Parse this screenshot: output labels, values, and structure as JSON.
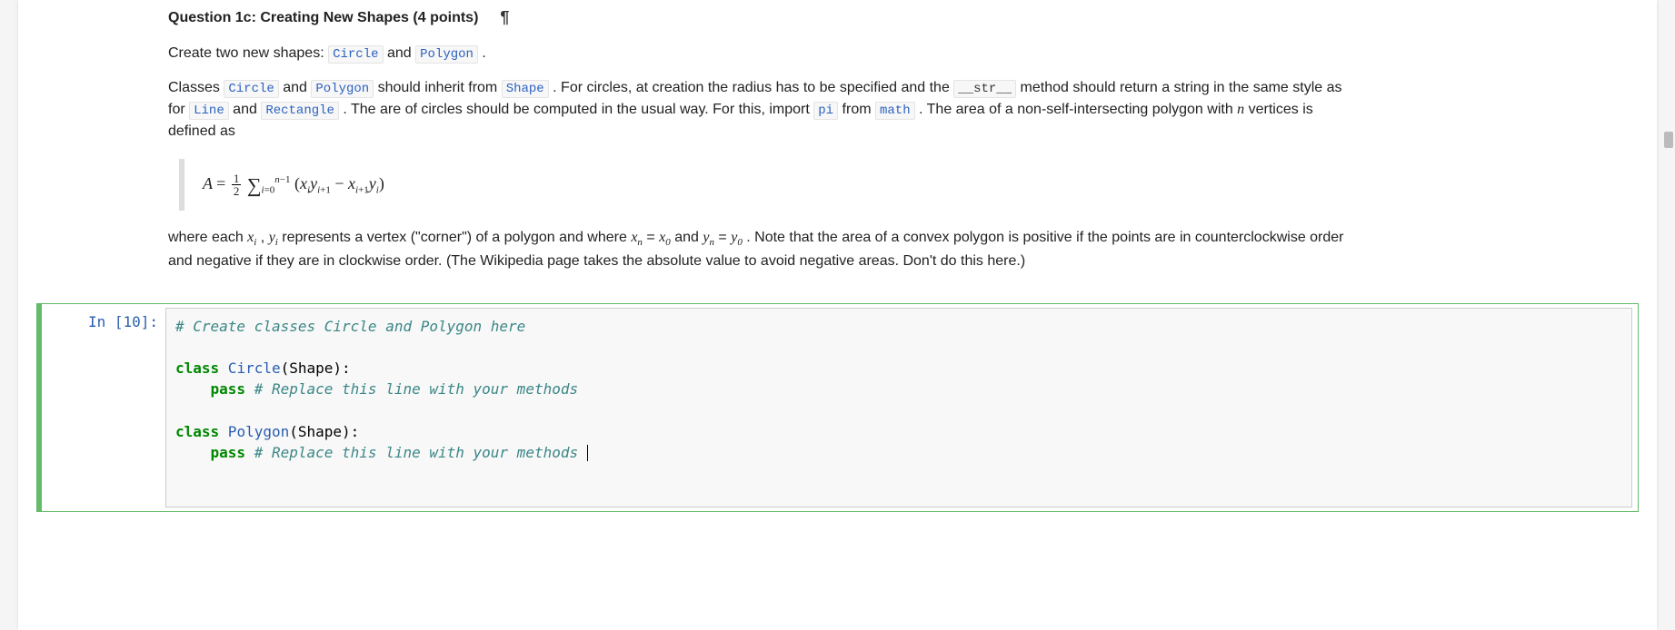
{
  "markdown": {
    "heading": "Question 1c: Creating New Shapes (4 points)",
    "pilcrow": "¶",
    "p1_pre": "Create two new shapes: ",
    "p1_c1": "Circle",
    "p1_mid": " and ",
    "p1_c2": "Polygon",
    "p1_post": " .",
    "p2_a": "Classes ",
    "p2_c1": "Circle",
    "p2_b": " and ",
    "p2_c2": "Polygon",
    "p2_c": " should inherit from ",
    "p2_c3": "Shape",
    "p2_d": " . For circles, at creation the radius has to be specified and the ",
    "p2_c4": "__str__",
    "p2_e": " method should return a string in the same style as for ",
    "p2_c5": "Line",
    "p2_f": " and ",
    "p2_c6": "Rectangle",
    "p2_g": " . The are of circles should be computed in the usual way. For this, import ",
    "p2_c7": "pi",
    "p2_h": " from ",
    "p2_c8": "math",
    "p2_i": " . The area of a non-self-intersecting polygon with ",
    "p2_n": "n",
    "p2_j": " vertices is defined as",
    "p3_a": "where each ",
    "p3_b": " represents a vertex (\"corner\") of a polygon and where ",
    "p3_c": " and ",
    "p3_d": " . Note that the area of a convex polygon is positive if the points are in counterclockwise order and negative if they are in clockwise order. (The Wikipedia page takes the absolute value to avoid negative areas. Don't do this here.)"
  },
  "code": {
    "prompt": "In [10]:",
    "l1": "# Create classes Circle and Polygon here",
    "l3_kw": "class",
    "l3_nm": " Circle",
    "l3_rest": "(Shape):",
    "l4_indent": "    ",
    "l4_kw": "pass",
    "l4_cm": " # Replace this line with your methods",
    "l6_kw": "class",
    "l6_nm": " Polygon",
    "l6_rest": "(Shape):",
    "l7_indent": "    ",
    "l7_kw": "pass",
    "l7_cm": " # Replace this line with your methods"
  }
}
